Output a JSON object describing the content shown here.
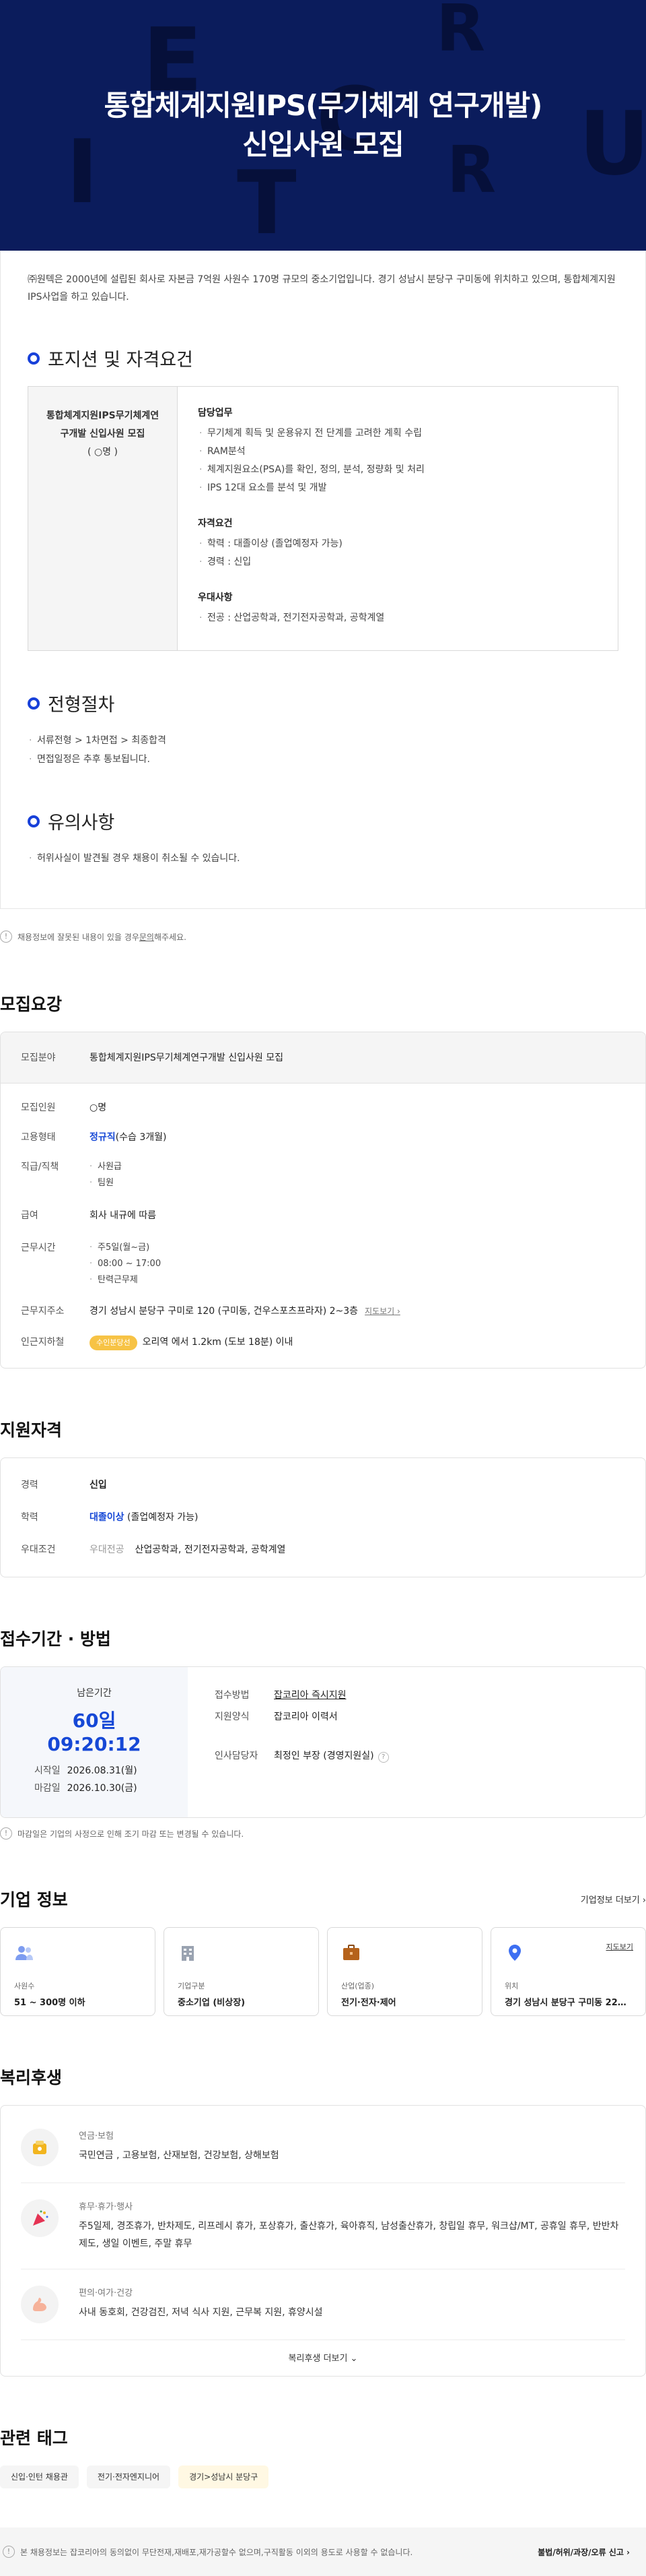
{
  "hero": {
    "title_line1": "통합체계지원IPS(무기체계 연구개발)",
    "title_line2": "신입사원 모집",
    "bg_letters": [
      "E",
      "C",
      "R",
      "U",
      "I",
      "T",
      "R"
    ]
  },
  "detail": {
    "intro": "㈜원텍은 2000년에 설립된 회사로 자본금 7억원 사원수 170명 규모의 중소기업입니다. 경기 성남시 분당구 구미동에 위치하고 있으며, 통합체계지원IPS사업을 하고 있습니다.",
    "position_heading": "포지션 및 자격요건",
    "position_title": "통합체계지원IPS무기체계연구개발 신입사원 모집",
    "position_count": "( ○명 )",
    "duties_title": "담당업무",
    "duties": [
      "무기체계 획득 및 운용유지 전 단계를 고려한 계획 수립",
      "RAM분석",
      "체계지원요소(PSA)를 확인, 정의, 분석, 정량화 및 처리",
      "IPS 12대 요소를 분석 및 개발"
    ],
    "qual_title": "자격요건",
    "quals": [
      "학력 : 대졸이상 (졸업예정자 가능)",
      "경력 : 신입"
    ],
    "pref_title": "우대사항",
    "prefs": [
      "전공 : 산업공학과, 전기전자공학과, 공학계열"
    ],
    "process_heading": "전형절차",
    "process": [
      "서류전형 > 1차면접 > 최종합격",
      "면접일정은 추후 통보됩니다."
    ],
    "caution_heading": "유의사항",
    "cautions": [
      "허위사실이 발견될 경우 채용이 취소될 수 있습니다."
    ]
  },
  "notice": {
    "text_before": "채용정보에 잘못된 내용이 있을 경우 ",
    "link": "문의",
    "text_after": "해주세요."
  },
  "summary": {
    "heading": "모집요강",
    "field_label": "모집분야",
    "field_value": "통합체계지원IPS무기체계연구개발 신입사원 모집",
    "headcount_label": "모집인원",
    "headcount_value": "○명",
    "emp_label": "고용형태",
    "emp_value": "정규직",
    "emp_note": "(수습 3개월)",
    "rank_label": "직급/직책",
    "ranks": [
      "사원급",
      "팀원"
    ],
    "salary_label": "급여",
    "salary_value": "회사 내규에 따름",
    "hours_label": "근무시간",
    "hours": [
      "주5일(월~금)",
      "08:00 ~ 17:00",
      "탄력근무제"
    ],
    "address_label": "근무지주소",
    "address_value": "경기 성남시 분당구 구미로 120 (구미동, 건우스포츠프라자) 2~3층",
    "map_link": "지도보기",
    "subway_label": "인근지하철",
    "subway_badge": "수인분당선",
    "subway_value": "오리역 에서 1.2km (도보 18분) 이내"
  },
  "qualification": {
    "heading": "지원자격",
    "career_label": "경력",
    "career_value": "신입",
    "edu_label": "학력",
    "edu_value": "대졸이상",
    "edu_note": "(졸업예정자 가능)",
    "pref_label": "우대조건",
    "pref_key": "우대전공",
    "pref_value": "산업공학과, 전기전자공학과, 공학계열"
  },
  "period": {
    "heading": "접수기간 · 방법",
    "remaining_label": "남은기간",
    "remaining_value": "60일 09:20:12",
    "start_label": "시작일",
    "start_value": "2026.08.31(월)",
    "end_label": "마감일",
    "end_value": "2026.10.30(금)",
    "method_label": "접수방법",
    "method_value": "잡코리아 즉시지원",
    "form_label": "지원양식",
    "form_value": "잡코리아 이력서",
    "hr_label": "인사담당자",
    "hr_value": "최정인 부장 (경영지원실)",
    "note": "마감일은 기업의 사정으로 인해 조기 마감 또는 변경될 수 있습니다."
  },
  "company": {
    "heading": "기업 정보",
    "more": "기업정보 더보기",
    "cards": [
      {
        "icon": "people-icon",
        "label": "사원수",
        "value": "51 ~ 300명 이하"
      },
      {
        "icon": "building-icon",
        "label": "기업구분",
        "value": "중소기업 (비상장)"
      },
      {
        "icon": "briefcase-icon",
        "label": "산업(업종)",
        "value": "전기·전자·제어"
      },
      {
        "icon": "location-pin-icon",
        "label": "위치",
        "value": "경기 성남시 분당구 구미동 226...",
        "link": "지도보기"
      }
    ]
  },
  "welfare": {
    "heading": "복리후생",
    "items": [
      {
        "icon": "piggy-bank-icon",
        "title": "연금·보험",
        "value": "국민연금 , 고용보험, 산재보험, 건강보험, 상해보험"
      },
      {
        "icon": "party-icon",
        "title": "휴무·휴가·행사",
        "value": "주5일제, 경조휴가, 반차제도, 리프레시 휴가, 포상휴가, 출산휴가, 육아휴직, 남성출산휴가, 창립일 휴무, 워크샵/MT, 공휴일 휴무, 반반차 제도, 생일 이벤트, 주말 휴무"
      },
      {
        "icon": "arm-icon",
        "title": "편의·여가·건강",
        "value": "사내 동호회, 건강검진, 저녁 식사 지원, 근무복 지원, 휴양시설"
      }
    ],
    "more": "복리후생 더보기"
  },
  "tags": {
    "heading": "관련 태그",
    "items": [
      "신입·인턴 채용관",
      "전기·전자엔지니어",
      "경기>성남시 분당구"
    ]
  },
  "footer": {
    "text": "본 채용정보는 잡코리아의 동의없이 무단전재,재배포,재가공할수 없으며,구직활동 이외의 용도로 사용할 수 없습니다.",
    "report": "불법/허위/과장/오류 신고"
  },
  "colors": {
    "hero_bg": "#0b1c5c",
    "accent": "#1648d6",
    "badge": "#f7c345"
  }
}
